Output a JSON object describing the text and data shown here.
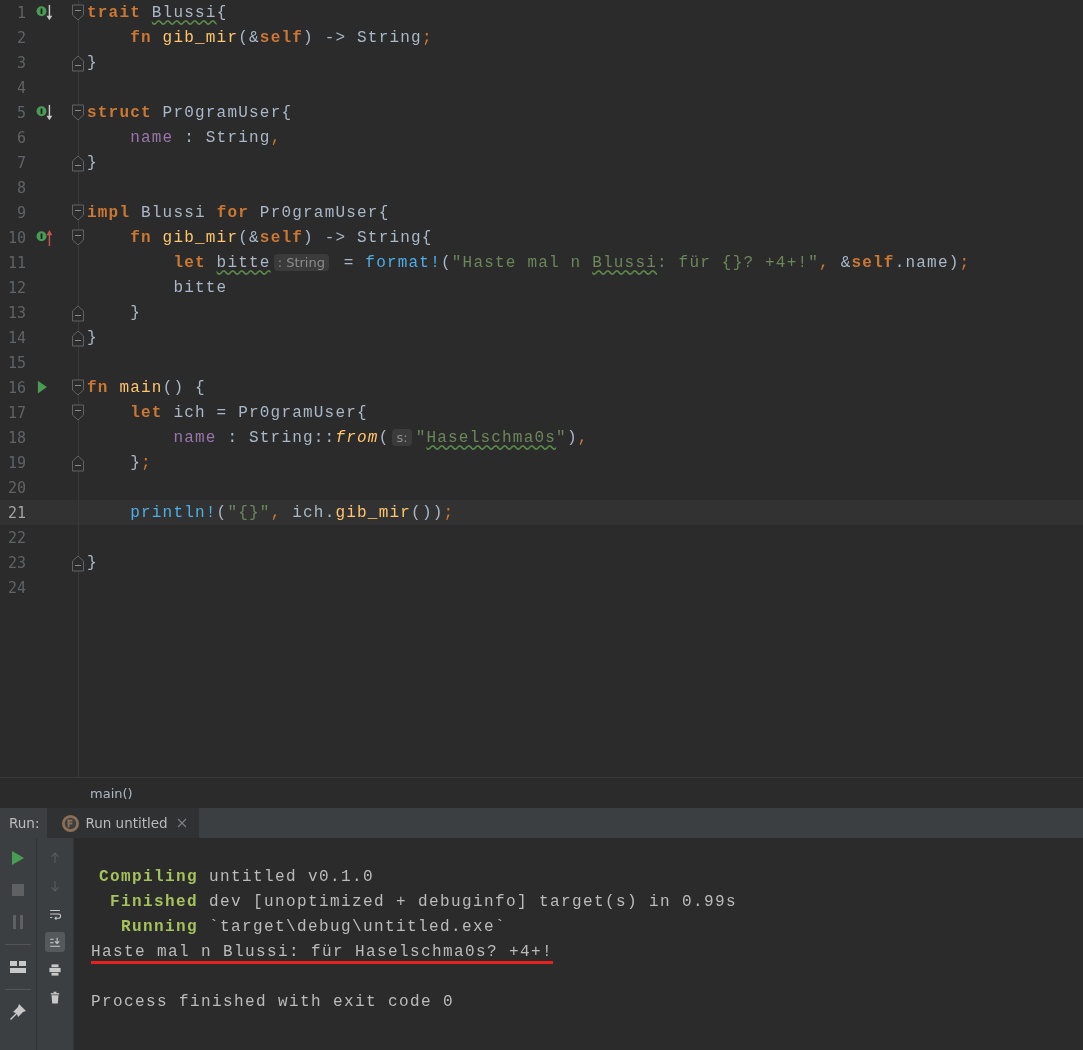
{
  "editor": {
    "lines": [
      {
        "number": "1",
        "gutter": {
          "kind": "implemented"
        },
        "fold": {
          "kind": "start"
        },
        "tokens": [
          {
            "kind": "kw",
            "t": "trait "
          },
          {
            "kind": "plain",
            "t": "Blussi",
            "typo": true
          },
          {
            "kind": "plain",
            "t": "{"
          }
        ],
        "children": [
          {
            "number": "2",
            "tokens": [
              {
                "kind": "kw",
                "t": "fn "
              },
              {
                "kind": "fn",
                "t": "gib_mir"
              },
              {
                "kind": "plain",
                "t": "(&"
              },
              {
                "kind": "kw",
                "t": "self"
              },
              {
                "kind": "plain",
                "t": ") -> String"
              },
              {
                "kind": "op",
                "t": ";"
              }
            ]
          }
        ]
      },
      {
        "number": "3",
        "fold": {
          "kind": "end"
        },
        "tokens": [
          {
            "kind": "plain",
            "t": "}"
          }
        ]
      },
      {
        "number": "4"
      },
      {
        "number": "5",
        "gutter": {
          "kind": "implemented"
        },
        "fold": {
          "kind": "start"
        },
        "tokens": [
          {
            "kind": "kw",
            "t": "struct"
          },
          {
            "kind": "plain",
            "t": " Pr0gramUser{"
          }
        ],
        "children": [
          {
            "number": "6",
            "tokens": [
              {
                "kind": "field",
                "t": "name"
              },
              {
                "kind": "plain",
                "t": " : String"
              },
              {
                "kind": "op",
                "t": ","
              }
            ]
          }
        ]
      },
      {
        "number": "7",
        "fold": {
          "kind": "end"
        },
        "tokens": [
          {
            "kind": "plain",
            "t": "}"
          }
        ]
      },
      {
        "number": "8"
      },
      {
        "number": "9",
        "fold": {
          "kind": "start"
        },
        "tokens": [
          {
            "kind": "kw",
            "t": "impl"
          },
          {
            "kind": "plain",
            "t": " Blussi "
          },
          {
            "kind": "kw",
            "t": "for"
          },
          {
            "kind": "plain",
            "t": " Pr0gramUser{"
          }
        ],
        "children": [
          {
            "number": "10",
            "gutter": {
              "kind": "implementing"
            },
            "fold": {
              "kind": "start"
            },
            "tokens": [
              {
                "kind": "kw",
                "t": "fn "
              },
              {
                "kind": "fn",
                "t": "gib_mir"
              },
              {
                "kind": "plain",
                "t": "(&"
              },
              {
                "kind": "kw",
                "t": "self"
              },
              {
                "kind": "plain",
                "t": ") -> String{"
              }
            ],
            "children": [
              {
                "number": "11",
                "tokens": [
                  {
                    "kind": "kw",
                    "t": "let "
                  },
                  {
                    "kind": "plain",
                    "t": "bitte",
                    "typo": true
                  },
                  {
                    "kind": "hint",
                    "t": ": String"
                  },
                  {
                    "kind": "plain",
                    "t": " = "
                  },
                  {
                    "kind": "macro",
                    "t": "format!"
                  },
                  {
                    "kind": "plain",
                    "t": "("
                  },
                  {
                    "kind": "str",
                    "t": "\"Haste mal n "
                  },
                  {
                    "kind": "str",
                    "t": "Blussi",
                    "typo": true
                  },
                  {
                    "kind": "str",
                    "t": ": für {}? +4+!\""
                  },
                  {
                    "kind": "op",
                    "t": ", "
                  },
                  {
                    "kind": "plain",
                    "t": "&"
                  },
                  {
                    "kind": "kw",
                    "t": "self"
                  },
                  {
                    "kind": "plain",
                    "t": ".name)"
                  },
                  {
                    "kind": "op",
                    "t": ";"
                  }
                ]
              },
              {
                "number": "12",
                "tokens": [
                  {
                    "kind": "plain",
                    "t": "bitte"
                  }
                ]
              }
            ]
          },
          {
            "number": "13",
            "fold": {
              "kind": "end"
            },
            "tokens": [
              {
                "kind": "plain",
                "t": "}"
              }
            ]
          }
        ]
      },
      {
        "number": "14",
        "fold": {
          "kind": "end"
        },
        "tokens": [
          {
            "kind": "plain",
            "t": "}"
          }
        ]
      },
      {
        "number": "15"
      },
      {
        "number": "16",
        "gutter": {
          "kind": "run"
        },
        "fold": {
          "kind": "start"
        },
        "tokens": [
          {
            "kind": "kw",
            "t": "fn "
          },
          {
            "kind": "fn",
            "t": "main"
          },
          {
            "kind": "plain",
            "t": "() {"
          }
        ],
        "children": [
          {
            "number": "17",
            "fold": {
              "kind": "start"
            },
            "tokens": [
              {
                "kind": "kw",
                "t": "let"
              },
              {
                "kind": "plain",
                "t": " ich = Pr0gramUser{"
              }
            ],
            "children": [
              {
                "number": "18",
                "tokens": [
                  {
                    "kind": "field",
                    "t": "name"
                  },
                  {
                    "kind": "plain",
                    "t": " : String::"
                  },
                  {
                    "kind": "call",
                    "t": "from"
                  },
                  {
                    "kind": "plain",
                    "t": "("
                  },
                  {
                    "kind": "hint",
                    "t": "s:"
                  },
                  {
                    "kind": "str",
                    "t": "\""
                  },
                  {
                    "kind": "str",
                    "t": "Haselschma0s",
                    "typo": true
                  },
                  {
                    "kind": "str",
                    "t": "\""
                  },
                  {
                    "kind": "plain",
                    "t": ")"
                  },
                  {
                    "kind": "op",
                    "t": ","
                  }
                ]
              }
            ]
          },
          {
            "number": "19",
            "fold": {
              "kind": "end"
            },
            "tokens": [
              {
                "kind": "plain",
                "t": "}"
              },
              {
                "kind": "op",
                "t": ";"
              }
            ]
          },
          {
            "number": "20"
          },
          {
            "number": "21",
            "current": true,
            "tokens": [
              {
                "kind": "macro",
                "t": "println!"
              },
              {
                "kind": "plain",
                "t": "("
              },
              {
                "kind": "str",
                "t": "\"{}\""
              },
              {
                "kind": "op",
                "t": ","
              },
              {
                "kind": "plain",
                "t": " ich."
              },
              {
                "kind": "fn",
                "t": "gib_mir"
              },
              {
                "kind": "plain",
                "t": "())"
              },
              {
                "kind": "op",
                "t": ";"
              }
            ]
          },
          {
            "number": "22"
          }
        ]
      },
      {
        "number": "23",
        "fold": {
          "kind": "end"
        },
        "tokens": [
          {
            "kind": "plain",
            "t": "}"
          }
        ]
      },
      {
        "number": "24"
      }
    ]
  },
  "breadcrumb": "main()",
  "run_panel": {
    "label": "Run:",
    "tabs": [
      {
        "label": "Run untitled",
        "selected": true
      }
    ],
    "toolbar_left": [
      {
        "kind": "run",
        "disabled": false
      },
      {
        "kind": "stop",
        "disabled": true
      },
      {
        "kind": "pause",
        "disabled": true
      },
      {
        "kind": "layout",
        "disabled": false
      },
      {
        "kind": "pin",
        "disabled": false
      }
    ],
    "toolbar_right": [
      {
        "kind": "up",
        "disabled": true,
        "selected": false
      },
      {
        "kind": "down",
        "disabled": true,
        "selected": false
      },
      {
        "kind": "wrap",
        "disabled": false,
        "selected": false
      },
      {
        "kind": "scroll-end",
        "disabled": false,
        "selected": true
      },
      {
        "kind": "print",
        "disabled": false,
        "selected": false
      },
      {
        "kind": "trash",
        "disabled": false,
        "selected": false
      }
    ],
    "console": [
      {
        "kind": "status",
        "label": "Compiling",
        "text": "untitled v0.1.0"
      },
      {
        "kind": "status",
        "label": "Finished",
        "text": "dev [unoptimized + debuginfo] target(s) in 0.99s"
      },
      {
        "kind": "status",
        "label": "Running",
        "text": "`target\\debug\\untitled.exe`"
      },
      {
        "kind": "output",
        "text": "Haste mal n Blussi: für Haselschma0s? +4+!",
        "underlined": true
      },
      {
        "kind": "system",
        "text": "Process finished with exit code 0"
      }
    ]
  }
}
